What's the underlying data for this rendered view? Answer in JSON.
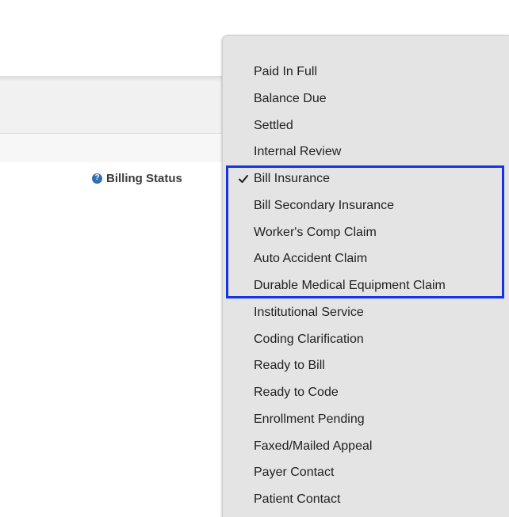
{
  "form": {
    "billing_status_label": "Billing Status",
    "help_icon": "question-circle-icon",
    "help_icon_glyph": "?"
  },
  "menu": {
    "selected_index": 4,
    "check_icon": "checkmark-icon",
    "items": [
      {
        "label": "Paid In Full"
      },
      {
        "label": "Balance Due"
      },
      {
        "label": "Settled"
      },
      {
        "label": "Internal Review"
      },
      {
        "label": "Bill Insurance",
        "checked": true
      },
      {
        "label": "Bill Secondary Insurance"
      },
      {
        "label": "Worker's Comp Claim"
      },
      {
        "label": "Auto Accident Claim"
      },
      {
        "label": "Durable Medical Equipment Claim"
      },
      {
        "label": "Institutional Service"
      },
      {
        "label": "Coding Clarification"
      },
      {
        "label": "Ready to Bill"
      },
      {
        "label": "Ready to Code"
      },
      {
        "label": "Enrollment Pending"
      },
      {
        "label": "Faxed/Mailed Appeal"
      },
      {
        "label": "Payer Contact"
      },
      {
        "label": "Patient Contact"
      }
    ]
  },
  "highlight": {
    "color": "#1434e6",
    "covers": [
      "Bill Insurance",
      "Bill Secondary Insurance",
      "Worker's Comp Claim",
      "Auto Accident Claim",
      "Durable Medical Equipment Claim"
    ]
  }
}
